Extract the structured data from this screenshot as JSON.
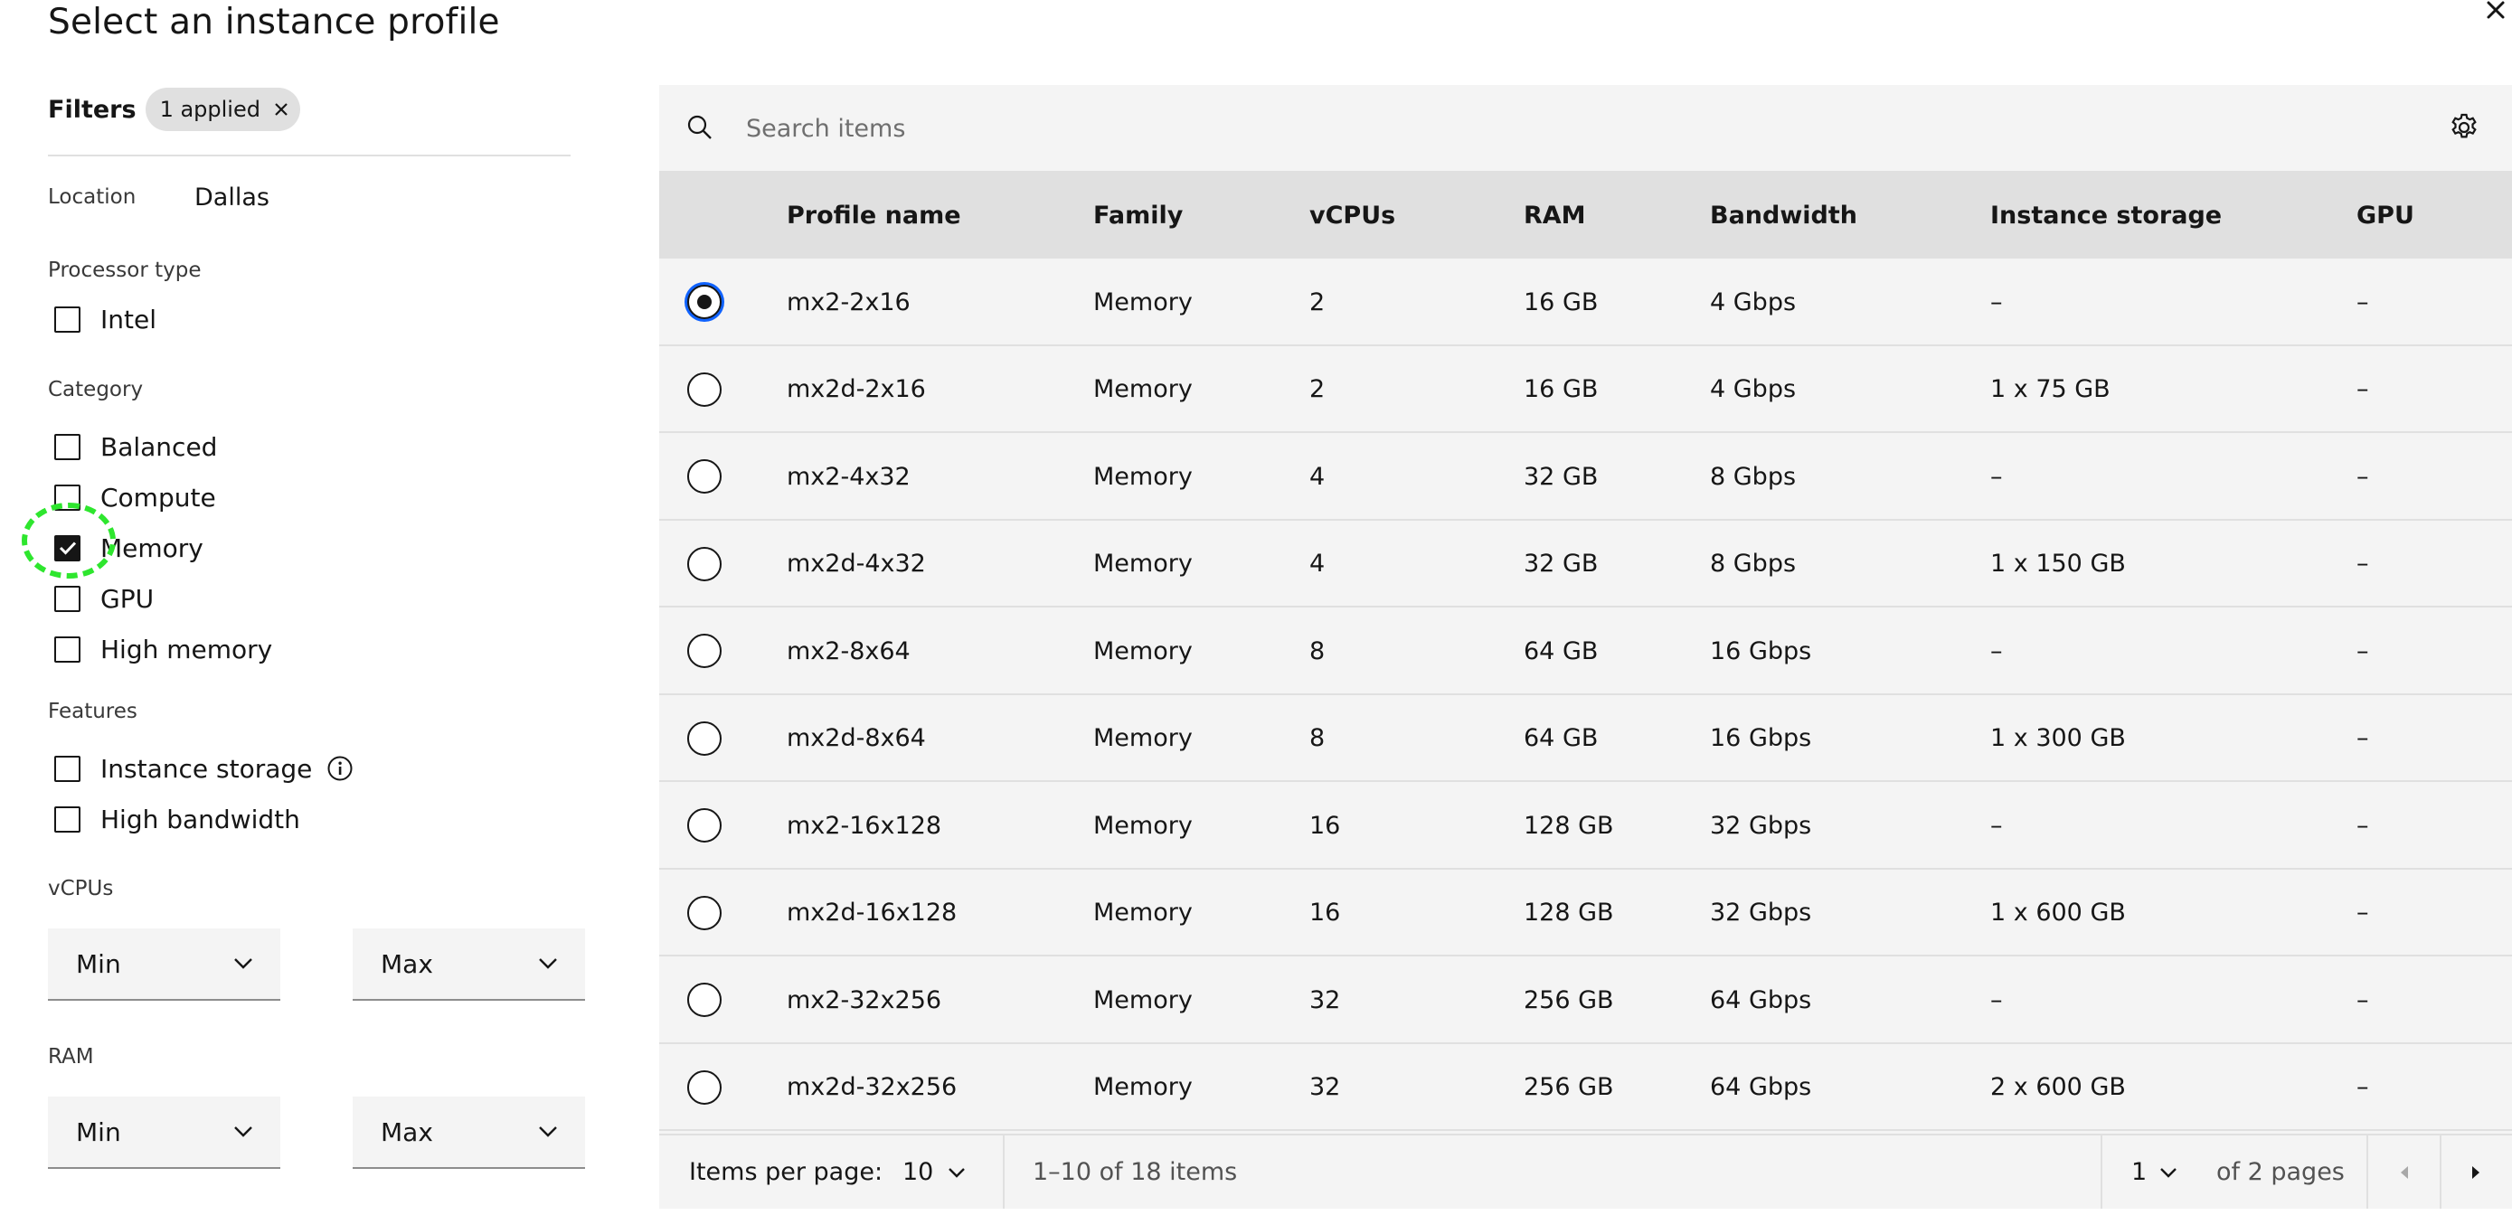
{
  "header": {
    "title": "Select an instance profile",
    "close_label": "×"
  },
  "filters": {
    "label": "Filters",
    "applied_tag": "1 applied",
    "location_label": "Location",
    "location_value": "Dallas",
    "processor_type": {
      "label": "Processor type",
      "options": [
        {
          "label": "Intel",
          "checked": false
        }
      ]
    },
    "category": {
      "label": "Category",
      "options": [
        {
          "label": "Balanced",
          "checked": false
        },
        {
          "label": "Compute",
          "checked": false
        },
        {
          "label": "Memory",
          "checked": true
        },
        {
          "label": "GPU",
          "checked": false
        },
        {
          "label": "High memory",
          "checked": false
        }
      ]
    },
    "features": {
      "label": "Features",
      "options": [
        {
          "label": "Instance storage",
          "checked": false,
          "info_icon": "information-icon"
        },
        {
          "label": "High bandwidth",
          "checked": false
        }
      ]
    },
    "vcpus": {
      "label": "vCPUs",
      "min": "Min",
      "max": "Max"
    },
    "ram": {
      "label": "RAM",
      "min": "Min",
      "max": "Max"
    }
  },
  "search": {
    "placeholder": "Search items",
    "icon": "search-icon",
    "settings_icon": "gear-icon"
  },
  "table": {
    "columns": [
      "Profile name",
      "Family",
      "vCPUs",
      "RAM",
      "Bandwidth",
      "Instance storage",
      "GPU"
    ],
    "rows": [
      {
        "name": "mx2-2x16",
        "family": "Memory",
        "vcpus": "2",
        "ram": "16 GB",
        "bandwidth": "4 Gbps",
        "storage": "–",
        "gpu": "–",
        "selected": true
      },
      {
        "name": "mx2d-2x16",
        "family": "Memory",
        "vcpus": "2",
        "ram": "16 GB",
        "bandwidth": "4 Gbps",
        "storage": "1 x 75 GB",
        "gpu": "–",
        "selected": false
      },
      {
        "name": "mx2-4x32",
        "family": "Memory",
        "vcpus": "4",
        "ram": "32 GB",
        "bandwidth": "8 Gbps",
        "storage": "–",
        "gpu": "–",
        "selected": false
      },
      {
        "name": "mx2d-4x32",
        "family": "Memory",
        "vcpus": "4",
        "ram": "32 GB",
        "bandwidth": "8 Gbps",
        "storage": "1 x 150 GB",
        "gpu": "–",
        "selected": false
      },
      {
        "name": "mx2-8x64",
        "family": "Memory",
        "vcpus": "8",
        "ram": "64 GB",
        "bandwidth": "16 Gbps",
        "storage": "–",
        "gpu": "–",
        "selected": false
      },
      {
        "name": "mx2d-8x64",
        "family": "Memory",
        "vcpus": "8",
        "ram": "64 GB",
        "bandwidth": "16 Gbps",
        "storage": "1 x 300 GB",
        "gpu": "–",
        "selected": false
      },
      {
        "name": "mx2-16x128",
        "family": "Memory",
        "vcpus": "16",
        "ram": "128 GB",
        "bandwidth": "32 Gbps",
        "storage": "–",
        "gpu": "–",
        "selected": false
      },
      {
        "name": "mx2d-16x128",
        "family": "Memory",
        "vcpus": "16",
        "ram": "128 GB",
        "bandwidth": "32 Gbps",
        "storage": "1 x 600 GB",
        "gpu": "–",
        "selected": false
      },
      {
        "name": "mx2-32x256",
        "family": "Memory",
        "vcpus": "32",
        "ram": "256 GB",
        "bandwidth": "64 Gbps",
        "storage": "–",
        "gpu": "–",
        "selected": false
      },
      {
        "name": "mx2d-32x256",
        "family": "Memory",
        "vcpus": "32",
        "ram": "256 GB",
        "bandwidth": "64 Gbps",
        "storage": "2 x 600 GB",
        "gpu": "–",
        "selected": false
      }
    ]
  },
  "pagination": {
    "items_per_page_label": "Items per page:",
    "items_per_page_value": "10",
    "range_text": "1–10 of 18 items",
    "page_value": "1",
    "pages_text": "of 2 pages",
    "prev_icon": "caret-left-icon",
    "next_icon": "caret-right-icon"
  },
  "colors": {
    "panel_bg": "#f4f4f4",
    "header_bg": "#e0e0e0",
    "focus": "#0f62fe",
    "highlight": "#2ee62e"
  }
}
